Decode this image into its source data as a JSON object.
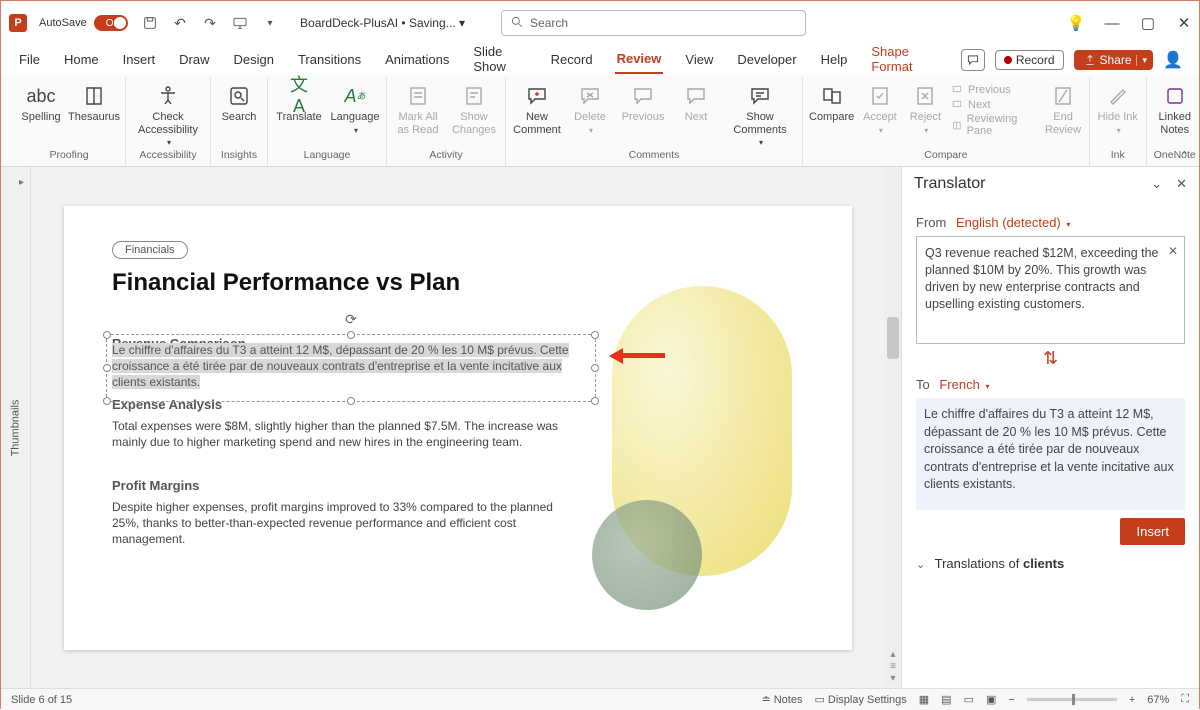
{
  "titlebar": {
    "autosave_label": "AutoSave",
    "autosave_state": "On",
    "doc": "BoardDeck-PlusAI • Saving... ",
    "search_placeholder": "Search"
  },
  "tabs": {
    "items": [
      "File",
      "Home",
      "Insert",
      "Draw",
      "Design",
      "Transitions",
      "Animations",
      "Slide Show",
      "Record",
      "Review",
      "View",
      "Developer",
      "Help",
      "Shape Format"
    ],
    "active_index": 9,
    "record_btn": "Record",
    "share_btn": "Share"
  },
  "ribbon": {
    "proofing": {
      "spelling": "Spelling",
      "thesaurus": "Thesaurus",
      "label": "Proofing"
    },
    "accessibility": {
      "check": "Check Accessibility",
      "label": "Accessibility"
    },
    "insights": {
      "search": "Search",
      "label": "Insights"
    },
    "language": {
      "translate": "Translate",
      "language": "Language",
      "label": "Language"
    },
    "activity": {
      "mark": "Mark All as Read",
      "show": "Show Changes",
      "label": "Activity"
    },
    "comments": {
      "new": "New Comment",
      "delete": "Delete",
      "previous": "Previous",
      "next": "Next",
      "show": "Show Comments",
      "label": "Comments"
    },
    "compare": {
      "compare": "Compare",
      "accept": "Accept",
      "reject": "Reject",
      "prev": "Previous",
      "next": "Next",
      "rp": "Reviewing Pane",
      "end": "End Review",
      "label": "Compare"
    },
    "ink": {
      "hide": "Hide Ink",
      "label": "Ink"
    },
    "onenote": {
      "linked": "Linked Notes",
      "label": "OneNote"
    }
  },
  "thumbnails_label": "Thumbnails",
  "slide": {
    "pill": "Financials",
    "title": "Financial Performance vs Plan",
    "s1_head": "Revenue Comparison",
    "s1_body": "Le chiffre d'affaires du T3 a atteint 12 M$, dépassant de 20 % les 10 M$ prévus. Cette croissance a été tirée par de nouveaux contrats d'entreprise et la vente incitative aux clients existants.",
    "s2_head": "Expense Analysis",
    "s2_body": "Total expenses were $8M, slightly higher than the planned $7.5M. The increase was mainly due to higher marketing spend and new hires in the engineering team.",
    "s3_head": "Profit Margins",
    "s3_body": "Despite higher expenses, profit margins improved to 33% compared to the planned 25%, thanks to better-than-expected revenue performance and efficient cost management."
  },
  "translator": {
    "title": "Translator",
    "from_label": "From",
    "from_lang": "English (detected)",
    "source_text": "Q3 revenue reached $12M, exceeding the planned $10M by 20%. This growth was driven by new enterprise contracts and upselling existing customers.",
    "to_label": "To",
    "to_lang": "French",
    "target_text": "Le chiffre d'affaires du T3 a atteint 12 M$, dépassant de 20 % les 10 M$ prévus. Cette croissance a été tirée par de nouveaux contrats d'entreprise et la vente incitative aux clients existants.",
    "insert": "Insert",
    "translations_of_prefix": "Translations of ",
    "translations_of_word": "clients"
  },
  "status": {
    "slide": "Slide 6 of 15",
    "notes": "Notes",
    "display": "Display Settings",
    "zoom": "67%"
  }
}
